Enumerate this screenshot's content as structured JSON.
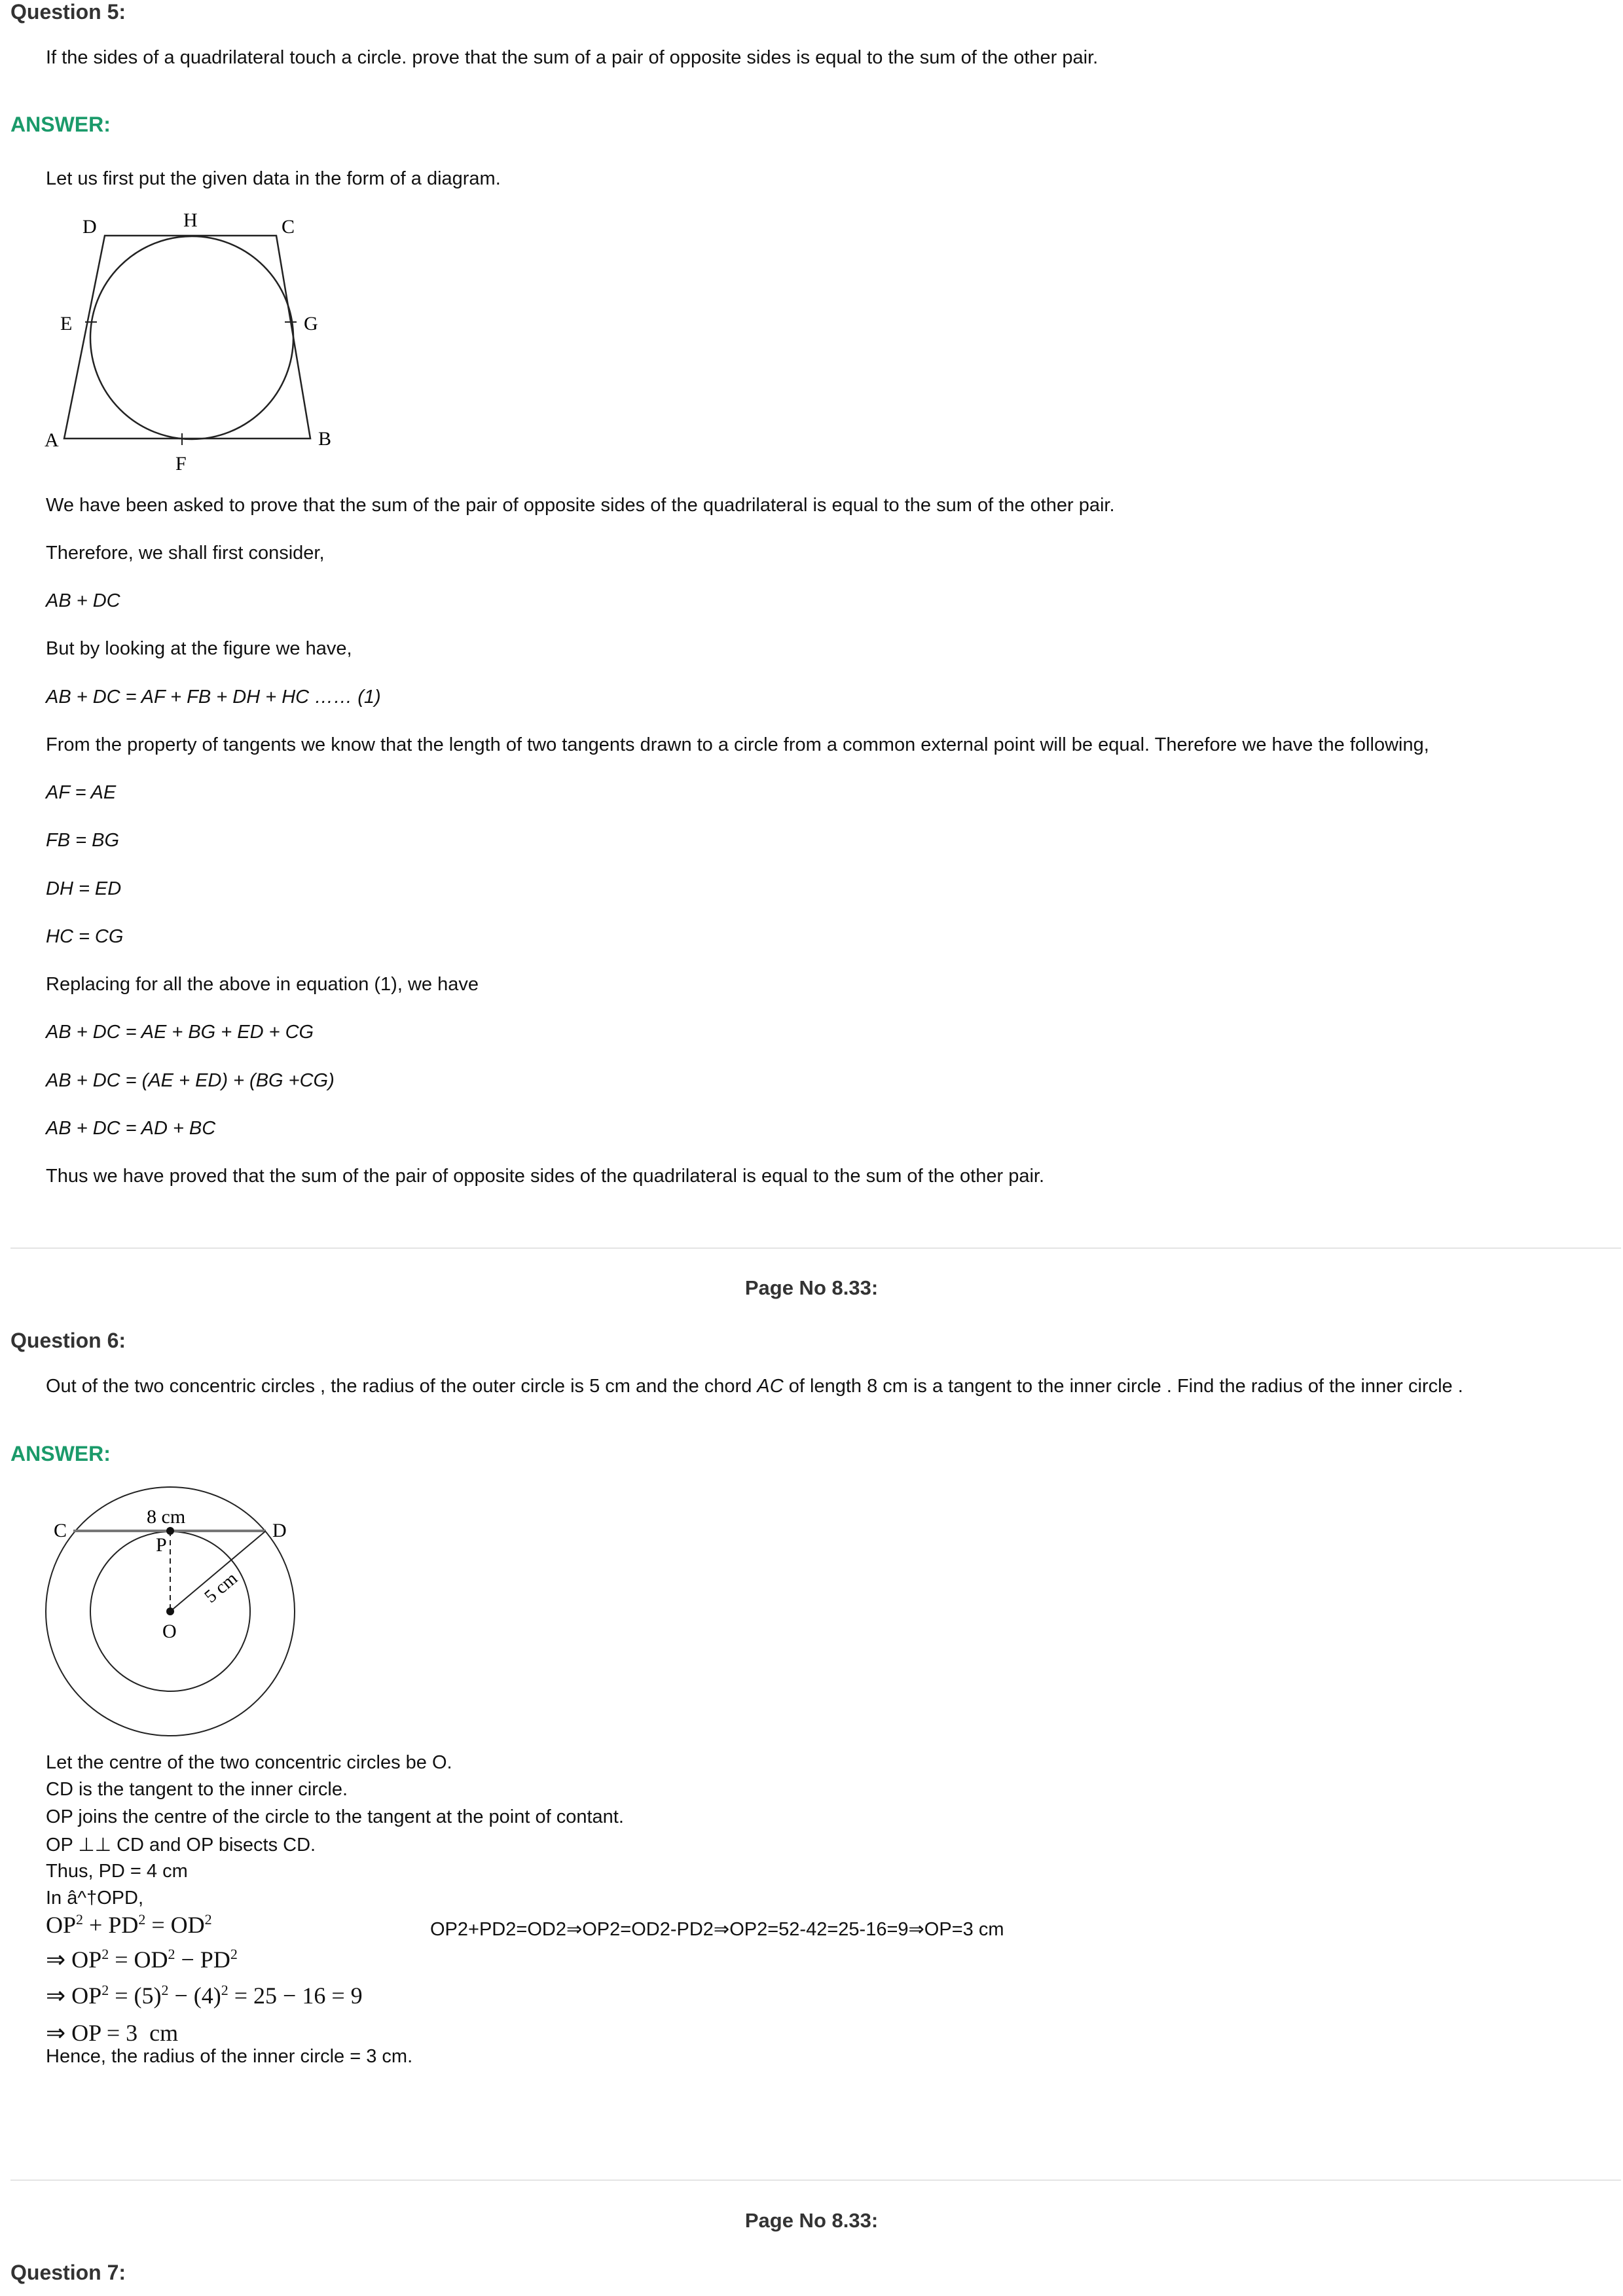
{
  "q5": {
    "heading": "Question 5:",
    "text": "If the sides of a quadrilateral touch a circle. prove that the sum of a pair of opposite sides is equal to the sum of the other pair.",
    "answer_label": "ANSWER:",
    "intro": "Let us first put the given data in the form of a diagram.",
    "diagram_labels": {
      "A": "A",
      "B": "B",
      "C": "C",
      "D": "D",
      "E": "E",
      "F": "F",
      "G": "G",
      "H": "H"
    },
    "lines": [
      "We have been asked to prove that the sum of the pair of opposite sides of the quadrilateral is equal to the sum of the other pair.",
      "Therefore, we shall first consider,",
      "AB + DC",
      "But by looking at the figure we have,",
      "AB + DC = AF + FB + DH + HC …… (1)",
      "From the property of tangents we know that the length of two tangents drawn to a circle from a common external point will be equal. Therefore we have the following,",
      "AF = AE",
      "FB = BG",
      "DH = ED",
      "HC = CG",
      "Replacing for all the above in equation (1), we have",
      "AB + DC = AE + BG + ED + CG",
      "AB + DC = (AE + ED) + (BG +CG)",
      "AB + DC = AD + BC",
      "Thus we have proved that the sum of the pair of opposite sides of the quadrilateral is equal to the sum of the other pair."
    ]
  },
  "page_no_1": "Page No 8.33:",
  "q6": {
    "heading": "Question 6:",
    "text_before": "Out of the two concentric circles , the radius of the outer circle is 5 cm and the chord ",
    "text_italic": "AC",
    "text_after": " of length 8 cm is a tangent to the inner circle . Find the radius of the inner circle .",
    "answer_label": "ANSWER:",
    "diagram_labels": {
      "C": "C",
      "D": "D",
      "P": "P",
      "O": "O",
      "chord": "8 cm",
      "radius": "5 cm"
    },
    "lines": [
      "Let the centre of the two concentric circles be O.",
      "CD is the tangent to the inner circle.",
      "OP joins the centre of the circle to the tangent at the point of contant.",
      "OP ⊥⊥ CD and OP bisects CD.",
      "Thus, PD = 4 cm",
      "In â^†OPD,"
    ],
    "math": {
      "l1": [
        "OP",
        "2",
        " + PD",
        "2",
        " = OD",
        "2"
      ],
      "l1_alt": "OP2+PD2=OD2⇒OP2=OD2-PD2⇒OP2=52-42=25-16=9⇒OP=3 cm",
      "l2": [
        "⇒ OP",
        "2",
        " = OD",
        "2",
        " − PD",
        "2"
      ],
      "l3": [
        "⇒ OP",
        "2",
        " = (5)",
        "2",
        " − (4)",
        "2",
        " = 25 − 16 = 9"
      ],
      "l4": "⇒ OP = 3  cm"
    },
    "conclusion": "Hence, the radius of the inner circle = 3 cm."
  },
  "page_no_2": "Page No 8.33:",
  "q7": {
    "heading": "Question 7:"
  }
}
